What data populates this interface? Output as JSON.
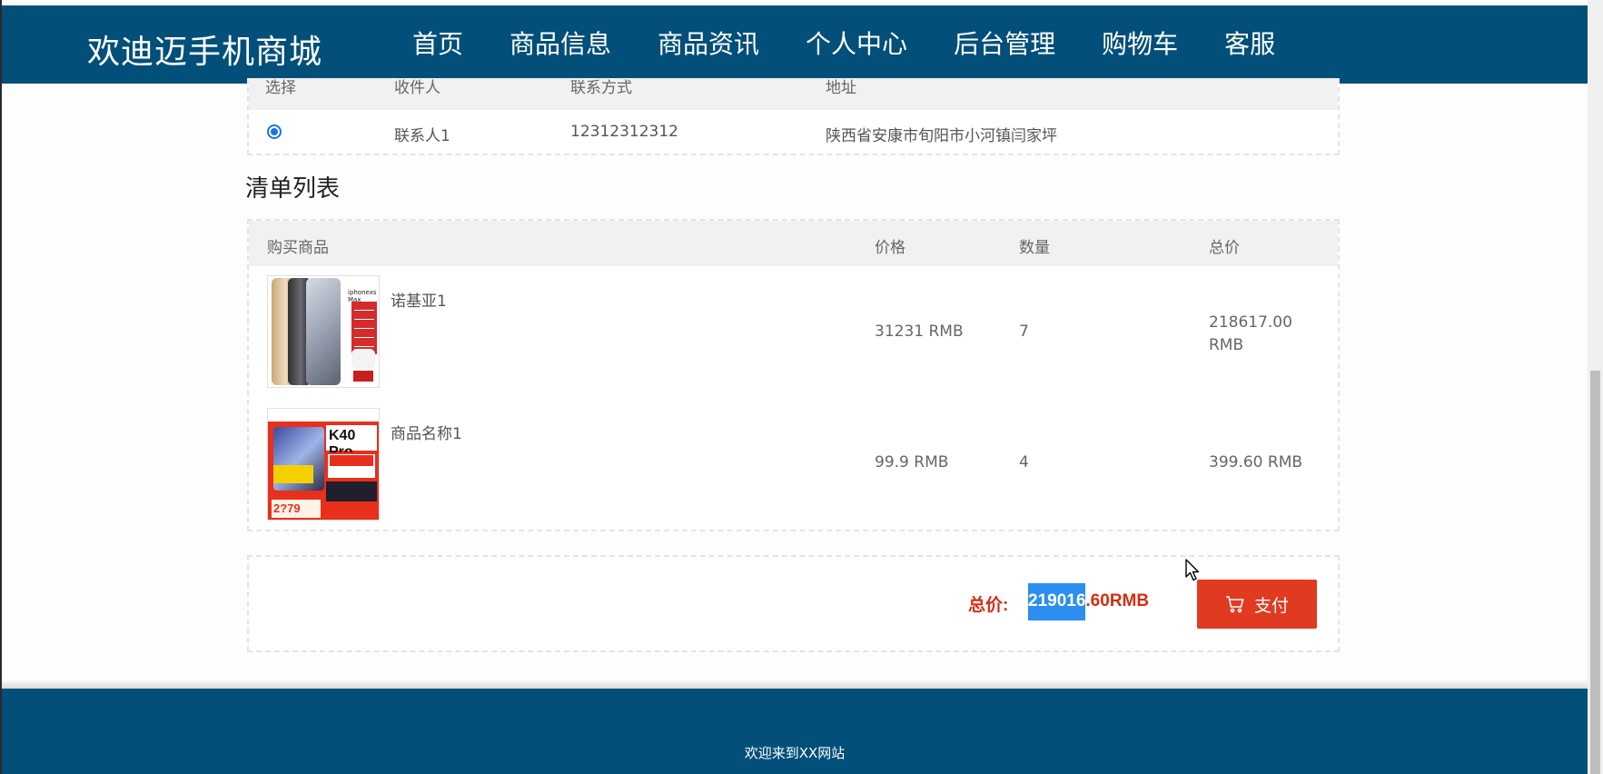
{
  "header": {
    "brand": "欢迪迈手机商城",
    "nav": [
      {
        "label": "首页",
        "active": false
      },
      {
        "label": "商品信息",
        "active": false
      },
      {
        "label": "商品资讯",
        "active": false
      },
      {
        "label": "个人中心",
        "active": false
      },
      {
        "label": "后台管理",
        "active": false
      },
      {
        "label": "购物车",
        "active": true
      },
      {
        "label": "客服",
        "active": false
      }
    ]
  },
  "address": {
    "headers": [
      "选择",
      "收件人",
      "联系方式",
      "地址"
    ],
    "rows": [
      {
        "selected": true,
        "name": "联系人1",
        "phone": "12312312312",
        "address": "陕西省安康市旬阳市小河镇闫家坪"
      }
    ]
  },
  "list": {
    "title": "清单列表",
    "headers": [
      "购买商品",
      "价格",
      "数量",
      "总价"
    ],
    "items": [
      {
        "name": "诺基亚1",
        "price": "31231 RMB",
        "qty": "7",
        "total_line1": "218617.00",
        "total_line2": "RMB",
        "thumb_text": "iphonexs Max"
      },
      {
        "name": "商品名称1",
        "price": "99.9 RMB",
        "qty": "4",
        "total_line1": "399.60 RMB",
        "total_line2": "",
        "thumb_text": "K40 Pro",
        "thumb_price": "2?79"
      }
    ]
  },
  "summary": {
    "label": "总价:",
    "value_selected": "219016",
    "value_rest": ".60RMB",
    "pay_label": "支付"
  },
  "footer": {
    "text": "欢迎来到XX网站"
  }
}
